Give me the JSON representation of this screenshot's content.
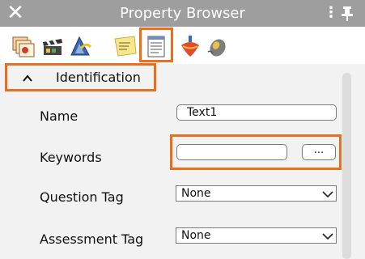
{
  "window": {
    "title": "Property Browser",
    "close_glyph": "✕",
    "menu_glyph": "⋮"
  },
  "toolbar": {
    "icons": [
      "slides-icon",
      "movie-clapper-icon",
      "drawing-triangle-icon",
      "sticky-note-icon",
      "document-properties-icon",
      "spinning-top-icon",
      "mouse-icon"
    ],
    "selected_icon": "document-properties-icon"
  },
  "section": {
    "label": "Identification",
    "expanded": true
  },
  "fields": {
    "name": {
      "label": "Name",
      "value": "Text1"
    },
    "keywords": {
      "label": "Keywords",
      "value": "",
      "browse_label": "..."
    },
    "question_tag": {
      "label": "Question Tag",
      "value": "None"
    },
    "assessment_tag": {
      "label": "Assessment Tag",
      "value": "None"
    }
  },
  "colors": {
    "highlight": "#e8701a",
    "titlebar": "#9e9e9e",
    "panel": "#f2f2f2"
  }
}
